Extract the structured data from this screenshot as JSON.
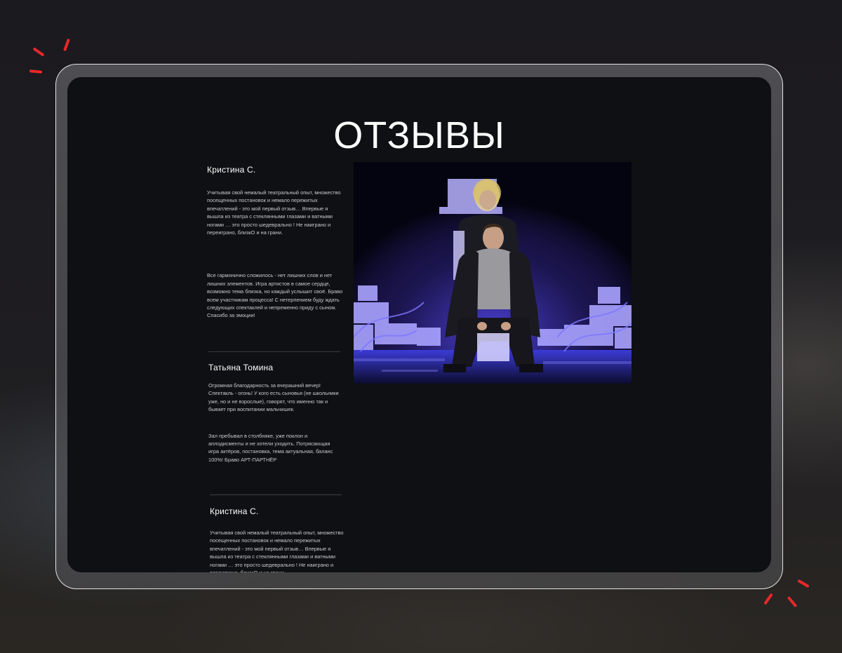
{
  "page": {
    "title": "ОТЗЫВЫ"
  },
  "reviews": [
    {
      "name": "Кристина С.",
      "paragraphs": [
        "Учитывая свой немалый театральный опыт, множество посещенных постановок и немало пережитых впечатлений - это мой первый отзыв… Впервые я вышла из театра с стеклянными глазами и ватными ногами … это просто шедеврально ! Не наиграно и переиграно, близкО и на грани.",
        "Все гармонично сложилось - нет лишних слов и нет лишних элементов. Игра артистов в самое сердце, возможно тема близка, но каждый услышит своё. Браво всем участникам процесса! С нетерпением буду ждать следующих спектаклей и непременно приду с сыном. Спасибо за эмоции!"
      ]
    },
    {
      "name": "Татьяна Томина",
      "paragraphs": [
        "Огромная благодарность за вчерашний вечер! Спектакль - огонь! У кого есть сыновья (не школьники уже, но и не взрослые), говорят, что именно так и бывает при воспитании мальчишек.",
        "Зал пребывал в столбняке, уже поклон и аплодисменты и не хотели уходить. Потрясающая игра актёров, постановка, тема актуальная, баланс 100%! Браво АРТ-ПАРТНЁР"
      ]
    },
    {
      "name": "Кристина С.",
      "paragraphs": [
        "Учитывая свой немалый театральный опыт, множество посещенных постановок и немало пережитых впечатлений - это мой первый отзыв… Впервые я вышла из театра с стеклянными глазами и ватными ногами … это просто шедеврально ! Не наиграно и переиграно, близкО и на грани."
      ]
    }
  ],
  "colors": {
    "accent": "#e8282a",
    "screen": "#0f1013",
    "stage_light": "#5a4cff"
  }
}
